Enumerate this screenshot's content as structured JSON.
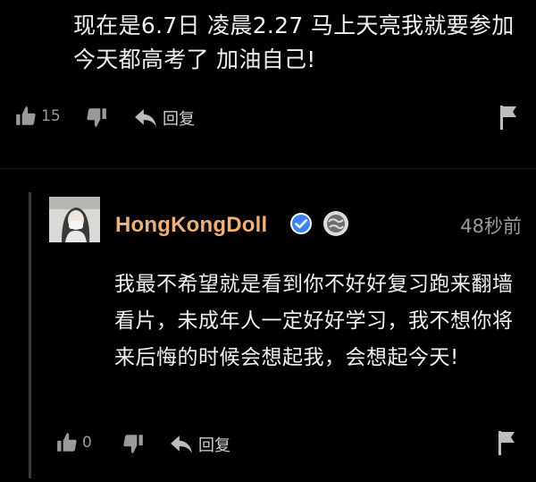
{
  "top_comment": {
    "text": "现在是6.7日 凌晨2.27 马上天亮我就要参加今天都高考了 加油自己!",
    "like_count": "15",
    "reply_label": "回复"
  },
  "reply": {
    "username": "HongKongDoll",
    "timestamp": "48秒前",
    "text": "我最不希望就是看到你不好好复习跑来翻墙看片，未成年人一定好好学习，我不想你将来后悔的时候会想起我，会想起今天!",
    "like_count": "0",
    "reply_label": "回复"
  },
  "icons": [
    "thumbs-up-icon",
    "thumbs-down-icon",
    "reply-arrow-icon",
    "flag-icon",
    "verified-icon",
    "globe-badge-icon"
  ],
  "colors": {
    "background": "#000000",
    "username": "#f0b07a",
    "verified": "#3b82f6",
    "muted": "#9a9a9a"
  }
}
